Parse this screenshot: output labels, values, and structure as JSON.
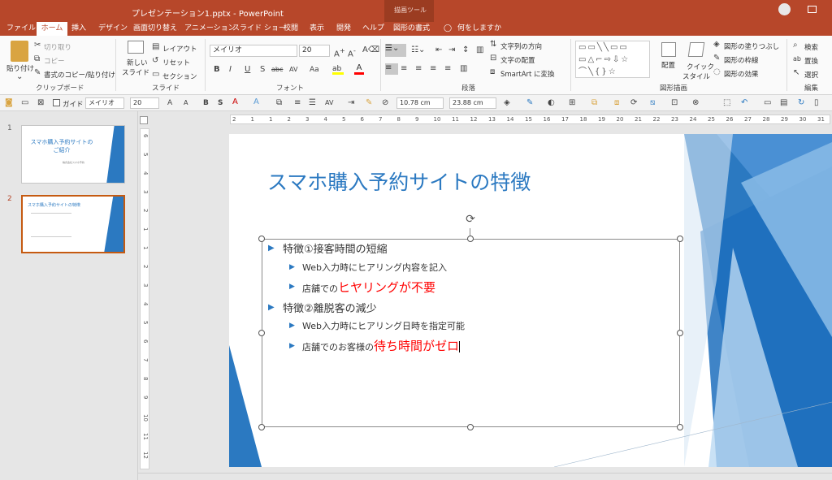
{
  "window": {
    "title": "プレゼンテーション1.pptx  -  PowerPoint",
    "context_tab_group": "描画ツール"
  },
  "tabs": [
    {
      "label": "ファイル",
      "selected": false
    },
    {
      "label": "ホーム",
      "selected": true
    },
    {
      "label": "挿入",
      "selected": false
    },
    {
      "label": "デザイン",
      "selected": false
    },
    {
      "label": "画面切り替え",
      "selected": false
    },
    {
      "label": "アニメーション",
      "selected": false
    },
    {
      "label": "スライド ショー",
      "selected": false
    },
    {
      "label": "校閲",
      "selected": false
    },
    {
      "label": "表示",
      "selected": false
    },
    {
      "label": "開発",
      "selected": false
    },
    {
      "label": "ヘルプ",
      "selected": false
    },
    {
      "label": "図形の書式",
      "selected": false
    }
  ],
  "tell_me": "何をしますか",
  "ribbon": {
    "clipboard": {
      "paste": "貼り付け",
      "cut": "切り取り",
      "copy": "コピー",
      "format_painter": "書式のコピー/貼り付け",
      "group": "クリップボード"
    },
    "slides": {
      "new_slide_1": "新しい",
      "new_slide_2": "スライド",
      "layout": "レイアウト",
      "reset": "リセット",
      "section": "セクション",
      "group": "スライド"
    },
    "font": {
      "name": "メイリオ",
      "size": "20",
      "group": "フォント",
      "bold": "B",
      "italic": "I",
      "underline": "U",
      "shadow": "S",
      "strike": "abc",
      "spacing": "AV",
      "case": "Aa"
    },
    "paragraph": {
      "text_direction": "文字列の方向",
      "align_text": "文字の配置",
      "smartart": "SmartArt に変換",
      "group": "段落"
    },
    "drawing": {
      "arrange": "配置",
      "quick_styles_1": "クイック",
      "quick_styles_2": "スタイル",
      "shape_fill": "図形の塗りつぶし",
      "shape_outline": "図形の枠線",
      "shape_effects": "図形の効果",
      "group": "図形描画"
    },
    "editing": {
      "find": "検索",
      "replace": "置換",
      "select": "選択",
      "group": "編集"
    }
  },
  "quick_toolbar": {
    "guide": "ガイド",
    "font": "メイリオ",
    "size": "20",
    "height": "10.78 cm",
    "width": "23.88 cm"
  },
  "thumbnails": [
    {
      "num": "1",
      "title": "スマホ購入予約サイトのご紹介",
      "subtitle": "株式会社スマホ予約"
    },
    {
      "num": "2",
      "title": "スマホ購入予約サイトの特徴"
    }
  ],
  "ruler": {
    "h": [
      "2",
      "1",
      "1",
      "2",
      "3",
      "4",
      "5",
      "6",
      "7",
      "8",
      "9",
      "10",
      "11",
      "12",
      "13",
      "14",
      "15",
      "16",
      "17",
      "18",
      "19",
      "20",
      "21",
      "22",
      "23",
      "24",
      "25",
      "26",
      "27",
      "28",
      "29",
      "30",
      "31"
    ],
    "v": [
      "6",
      "5",
      "4",
      "3",
      "2",
      "1",
      "1",
      "2",
      "3",
      "4",
      "5",
      "6",
      "7",
      "8",
      "9",
      "10",
      "11",
      "12"
    ]
  },
  "slide": {
    "title": "スマホ購入予約サイトの特徴",
    "l1a": "特徴①接客時間の短縮",
    "l2a": "Web入力時にヒアリング内容を記入",
    "l2b_pre": "店舗での",
    "l2b_red": "ヒヤリングが不要",
    "l1b": "特徴②離脱客の減少",
    "l2c": "Web入力時にヒアリング日時を指定可能",
    "l2d_pre": "店舗でのお客様の",
    "l2d_red": "待ち時間がゼロ"
  },
  "colors": {
    "accent": "#b7472a",
    "title_blue": "#2b79c1",
    "red_text": "#ff0000"
  }
}
